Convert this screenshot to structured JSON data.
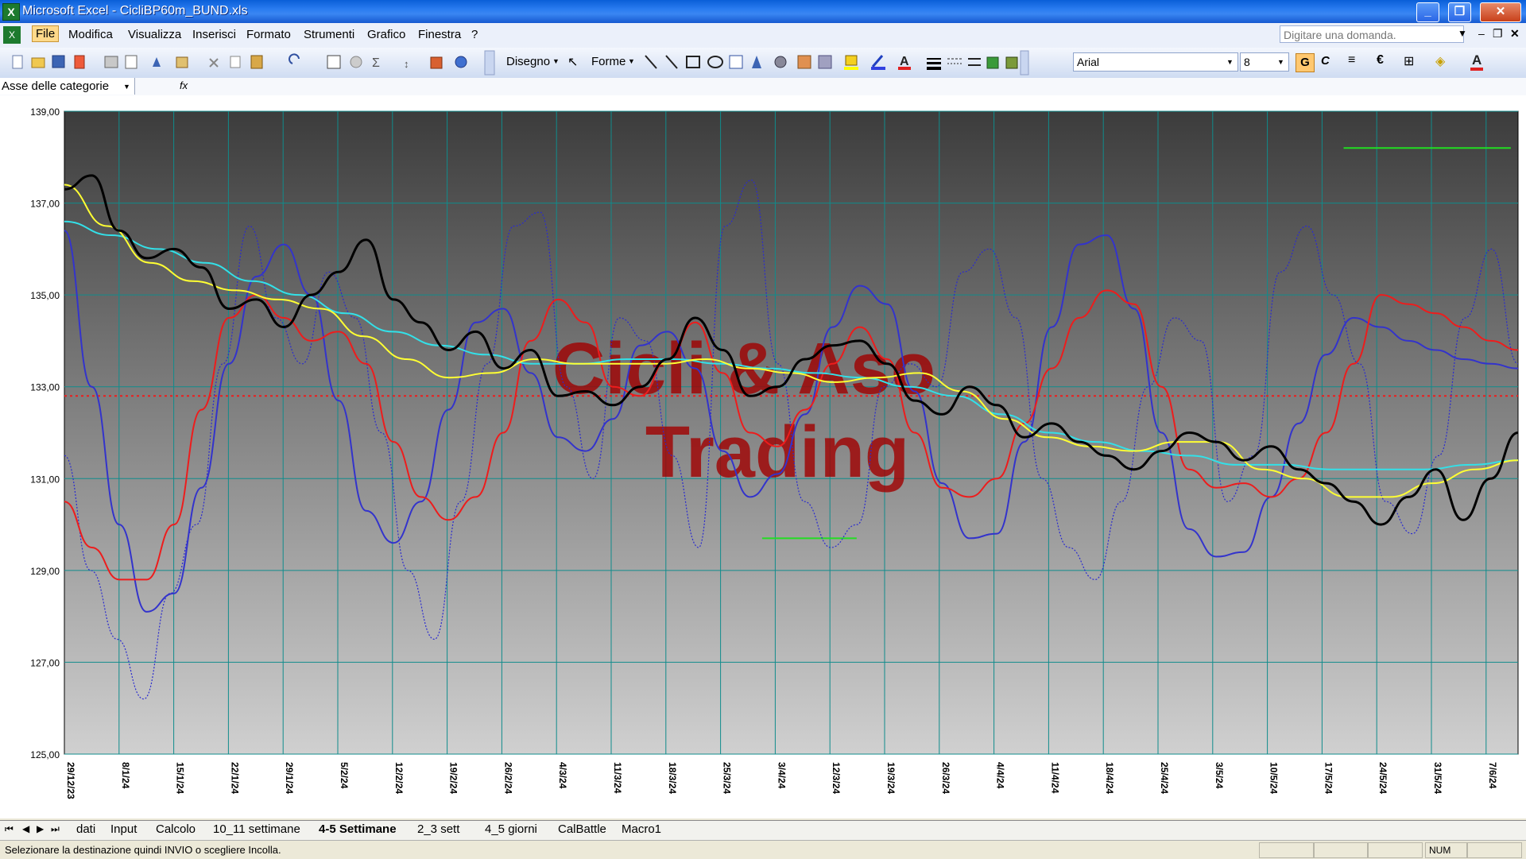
{
  "window": {
    "title": "Microsoft Excel - CicliBP60m_BUND.xls",
    "app_icon": "excel-icon",
    "buttons": [
      "minimize",
      "restore",
      "close"
    ]
  },
  "menubar": {
    "items": [
      "File",
      "Modifica",
      "Visualizza",
      "Inserisci",
      "Formato",
      "Strumenti",
      "Grafico",
      "Finestra",
      "?"
    ],
    "ask_placeholder": "Digitare una domanda."
  },
  "toolbar": {
    "draw_label": "Disegno",
    "shapes_label": "Forme",
    "font_name": "Arial",
    "font_size": "8",
    "bold_label": "G",
    "italic_label": "C",
    "euro_label": "€"
  },
  "formula_bar": {
    "namebox": "Asse delle categorie",
    "fx": "fx"
  },
  "chart_data": {
    "type": "line",
    "y_ticks": [
      "139,00",
      "137,00",
      "135,00",
      "133,00",
      "131,00",
      "129,00",
      "127,00",
      "125,00"
    ],
    "ylim": [
      125,
      139
    ],
    "x_ticks": [
      "29/12/23",
      "8/1/24",
      "15/1/24",
      "22/1/24",
      "29/1/24",
      "5/2/24",
      "12/2/24",
      "19/2/24",
      "26/2/24",
      "4/3/24",
      "11/3/24",
      "18/3/24",
      "25/3/24",
      "3/4/24",
      "12/3/24",
      "19/3/24",
      "26/3/24",
      "4/4/24",
      "11/4/24",
      "18/4/24",
      "25/4/24",
      "3/5/24",
      "10/5/24",
      "17/5/24",
      "24/5/24",
      "31/5/24",
      "7/6/24"
    ],
    "watermark": [
      "Cicli & Aso",
      "Trading"
    ],
    "reference_line": {
      "value": 132.8,
      "color": "#ee1c1c",
      "style": "dotted"
    },
    "series": [
      {
        "color": "#000000",
        "values": [
          137.3,
          137.6,
          136.4,
          135.8,
          136.0,
          135.6,
          134.7,
          134.9,
          134.3,
          135.0,
          135.5,
          136.2,
          134.9,
          134.4,
          133.8,
          134.2,
          133.4,
          133.8,
          132.8,
          132.9,
          132.6,
          133.0,
          133.6,
          134.5,
          133.8,
          132.8,
          133.0,
          133.6,
          133.9,
          134.0,
          133.5,
          132.7,
          132.4,
          133.0,
          132.6,
          131.9,
          132.2,
          131.8,
          131.5,
          131.2,
          131.6,
          132.0,
          131.8,
          131.4,
          131.7,
          131.2,
          130.9,
          130.5,
          130.0,
          130.6,
          131.2,
          130.1,
          131.0,
          132.0
        ]
      },
      {
        "color": "#ee1c1c",
        "values": [
          130.5,
          129.5,
          128.8,
          128.8,
          130.0,
          132.5,
          134.5,
          135.0,
          134.5,
          134.0,
          134.2,
          133.5,
          131.8,
          130.6,
          130.1,
          130.6,
          132.0,
          134.0,
          134.9,
          134.4,
          133.0,
          132.8,
          133.6,
          134.4,
          133.3,
          132.0,
          131.7,
          132.5,
          133.5,
          134.3,
          133.6,
          132.0,
          130.8,
          130.6,
          131.0,
          132.2,
          133.4,
          134.5,
          135.1,
          134.8,
          133.0,
          131.2,
          130.8,
          130.9,
          130.6,
          131.0,
          132.0,
          133.5,
          135.0,
          134.8,
          134.6,
          134.3,
          134.0,
          133.8
        ]
      },
      {
        "color": "#3333cc",
        "values": [
          136.4,
          133.0,
          130.0,
          128.1,
          128.5,
          130.8,
          133.5,
          135.4,
          136.1,
          135.0,
          132.7,
          130.3,
          129.6,
          130.5,
          132.5,
          134.4,
          134.7,
          133.3,
          131.9,
          131.6,
          132.3,
          133.9,
          134.2,
          133.4,
          131.6,
          130.6,
          131.1,
          132.4,
          134.3,
          135.2,
          134.8,
          132.9,
          130.9,
          129.7,
          129.8,
          131.8,
          134.3,
          136.1,
          136.3,
          134.7,
          132.0,
          129.9,
          129.3,
          129.4,
          130.6,
          132.2,
          133.7,
          134.5,
          134.3,
          134.0,
          133.8,
          133.6,
          133.5,
          133.4
        ]
      },
      {
        "color": "#ffff33",
        "values": [
          137.4,
          136.5,
          135.7,
          135.3,
          135.1,
          134.9,
          134.7,
          134.1,
          133.6,
          133.2,
          133.3,
          133.6,
          133.5,
          133.5,
          133.5,
          133.6,
          133.4,
          133.3,
          133.1,
          133.2,
          133.3,
          132.9,
          132.3,
          131.9,
          131.7,
          131.6,
          131.8,
          131.8,
          131.2,
          131.0,
          130.6,
          130.6,
          130.9,
          131.2,
          131.4
        ]
      },
      {
        "color": "#33e0e8",
        "values": [
          136.6,
          136.3,
          136.0,
          135.7,
          135.3,
          135.0,
          134.6,
          134.2,
          133.9,
          133.7,
          133.5,
          133.5,
          133.6,
          133.6,
          133.5,
          133.4,
          133.3,
          133.2,
          133.0,
          132.8,
          132.4,
          132.0,
          131.8,
          131.6,
          131.5,
          131.3,
          131.3,
          131.2,
          131.2,
          131.2,
          131.3,
          131.4
        ]
      },
      {
        "color": "#2a2ad0",
        "style": "dotted",
        "values": [
          131.5,
          129.0,
          127.5,
          126.2,
          128.5,
          130.0,
          133.5,
          136.5,
          134.5,
          133.5,
          135.5,
          134.5,
          132.0,
          129.0,
          127.5,
          130.5,
          133.5,
          136.5,
          136.8,
          133.0,
          131.0,
          134.5,
          134.0,
          131.5,
          129.5,
          136.5,
          137.5,
          133.5,
          130.5,
          129.5,
          130.0,
          133.0,
          133.5,
          133.0,
          135.5,
          136.0,
          134.5,
          131.0,
          129.5,
          128.8,
          130.5,
          133.0,
          134.5,
          134.0,
          130.5,
          131.5,
          135.5,
          136.5,
          135.0,
          133.5,
          130.5,
          129.8,
          131.5,
          134.5,
          136.0,
          133.5
        ]
      }
    ],
    "green_segments": [
      {
        "value": 138.2,
        "from_pct": 0.88,
        "to_pct": 0.995
      },
      {
        "value": 129.7,
        "from_pct": 0.48,
        "to_pct": 0.545
      }
    ]
  },
  "sheet_tabs": {
    "items": [
      "dati",
      "Input",
      "Calcolo",
      "10_11 settimane",
      "4-5 Settimane",
      "2_3 sett",
      "4_5 giorni",
      "CalBattle",
      "Macro1"
    ],
    "active": "4-5 Settimane"
  },
  "status": {
    "text": "Selezionare la destinazione quindi INVIO o scegliere Incolla.",
    "num": "NUM"
  }
}
